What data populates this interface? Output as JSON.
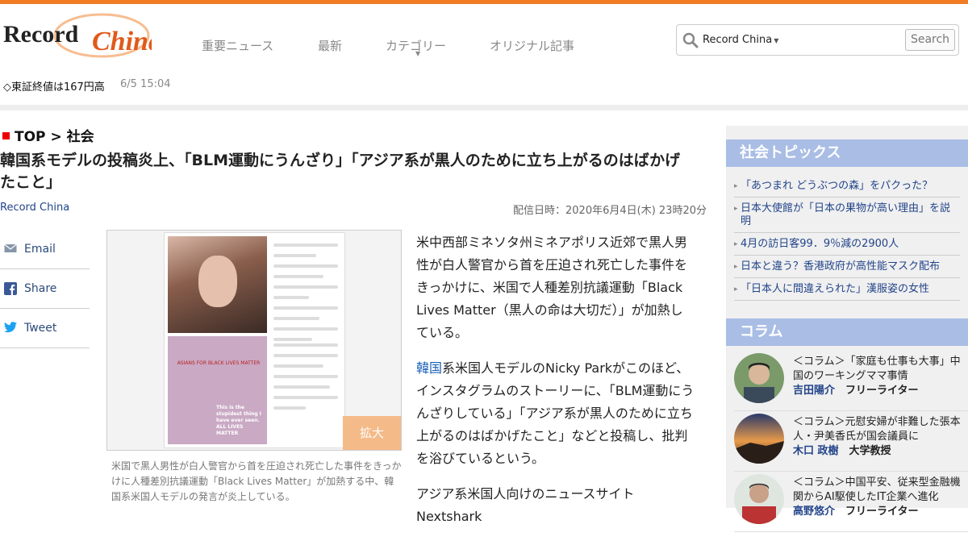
{
  "header": {
    "logo_text": "Record China",
    "nav": [
      "重要ニュース",
      "最新",
      "カテゴリー",
      "オリジナル記事"
    ],
    "search": {
      "scope": "Record China",
      "button": "Search"
    },
    "ticker": {
      "text": "◇東証終値は167円高",
      "time": "6/5 15:04"
    }
  },
  "article": {
    "breadcrumb_top": "TOP",
    "breadcrumb_sep": ">",
    "breadcrumb_section": "社会",
    "title": "韓国系モデルの投稿炎上、「BLM運動にうんざり」「アジア系が黒人のために立ち上がるのはばかげたこと」",
    "source": "Record China",
    "date": "配信日時：2020年6月4日(木) 23時20分",
    "share": [
      "Email",
      "Share",
      "Tweet"
    ],
    "figure": {
      "enlarge": "拡大",
      "caption": "米国で黒人男性が白人警官から首を圧迫され死亡した事件をきっかけに人種差別抗議運動「Black Lives Matter」が加熱する中、韓国系米国人モデルの発言が炎上している。",
      "post_text": "ASIANS FOR BLACK LIVES MATTER",
      "quote": "This is the stupidest thing I have ever seen. ALL LIVES MATTER"
    },
    "para1": "米中西部ミネソタ州ミネアポリス近郊で黒人男性が白人警官から首を圧迫され死亡した事件をきっかけに、米国で人種差別抗議運動「Black Lives Matter（黒人の命は大切だ）」が加熱している。",
    "para2_kw": "韓国",
    "para2_rest": "系米国人モデルのNicky Parkがこのほど、インスタグラムのストーリーに、「BLM運動にうんざりしている」「アジア系が黒人のために立ち上がるのはばかげたこと」などと投稿し、批判を浴びているという。",
    "para3": "アジア系米国人向けのニュースサイトNextshark"
  },
  "sidebar": {
    "topics_title": "社会トピックス",
    "topics": [
      "「あつまれ どうぶつの森」をパクった？",
      "日本大使館が「日本の果物が高い理由」を説明",
      "4月の訪日客99．9％減の2900人",
      "日本と違う？香港政府が高性能マスク配布",
      "「日本人に間違えられた」漢服姿の女性"
    ],
    "columns_title": "コラム",
    "columns": [
      {
        "title": "＜コラム＞「家庭も仕事も大事」中国のワーキングママ事情",
        "author": "吉田陽介",
        "role": "フリーライター"
      },
      {
        "title": "＜コラム＞元慰安婦が非難した張本人・尹美香氏が国会議員に",
        "author": "木口 政樹",
        "role": "大学教授"
      },
      {
        "title": "＜コラム＞中国平安、従来型金融機関からAI駆使したIT企業へ進化",
        "author": "高野悠介",
        "role": "フリーライター"
      }
    ]
  }
}
